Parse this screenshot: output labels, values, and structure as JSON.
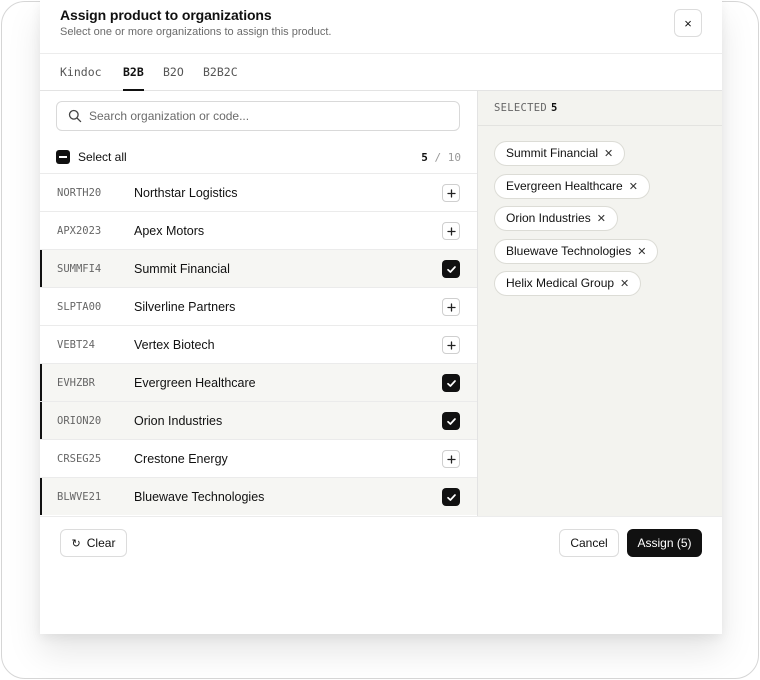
{
  "dialog": {
    "title": "Assign product to organizations",
    "subtitle": "Select one or more organizations to assign this product.",
    "close_label": "×"
  },
  "tabs": [
    {
      "label": "Kindoc",
      "active": false
    },
    {
      "label": "B2B",
      "active": true
    },
    {
      "label": "B2O",
      "active": false
    },
    {
      "label": "B2B2C",
      "active": false
    }
  ],
  "search": {
    "placeholder": "Search organization or code...",
    "value": ""
  },
  "select_all": {
    "label": "Select all",
    "selected_count": "5",
    "separator": " / ",
    "total": "10"
  },
  "organizations": [
    {
      "code": "NORTH20",
      "name": "Northstar Logistics",
      "selected": false
    },
    {
      "code": "APX2023",
      "name": "Apex Motors",
      "selected": false
    },
    {
      "code": "SUMMFI4",
      "name": "Summit Financial",
      "selected": true
    },
    {
      "code": "SLPTA00",
      "name": "Silverline Partners",
      "selected": false
    },
    {
      "code": "VEBT24",
      "name": "Vertex Biotech",
      "selected": false
    },
    {
      "code": "EVHZBR",
      "name": "Evergreen Healthcare",
      "selected": true
    },
    {
      "code": "ORION20",
      "name": "Orion Industries",
      "selected": true
    },
    {
      "code": "CRSEG25",
      "name": "Crestone Energy",
      "selected": false
    },
    {
      "code": "BLWVE21",
      "name": "Bluewave Technologies",
      "selected": true
    }
  ],
  "selected_panel": {
    "heading": "SELECTED",
    "count": "5",
    "chips": [
      "Summit Financial",
      "Evergreen Healthcare",
      "Orion Industries",
      "Bluewave Technologies",
      "Helix Medical Group"
    ]
  },
  "footer": {
    "clear_label": "Clear",
    "cancel_label": "Cancel",
    "assign_label": "Assign (5)"
  },
  "colors": {
    "accent": "#111111",
    "selected_row_bg": "#f6f6f3",
    "panel_bg": "#f3f3ef"
  },
  "icons": {
    "search": "search-icon",
    "close": "close-icon",
    "add": "plus-icon",
    "check": "check-icon",
    "remove": "x-icon",
    "reset": "refresh-icon"
  }
}
